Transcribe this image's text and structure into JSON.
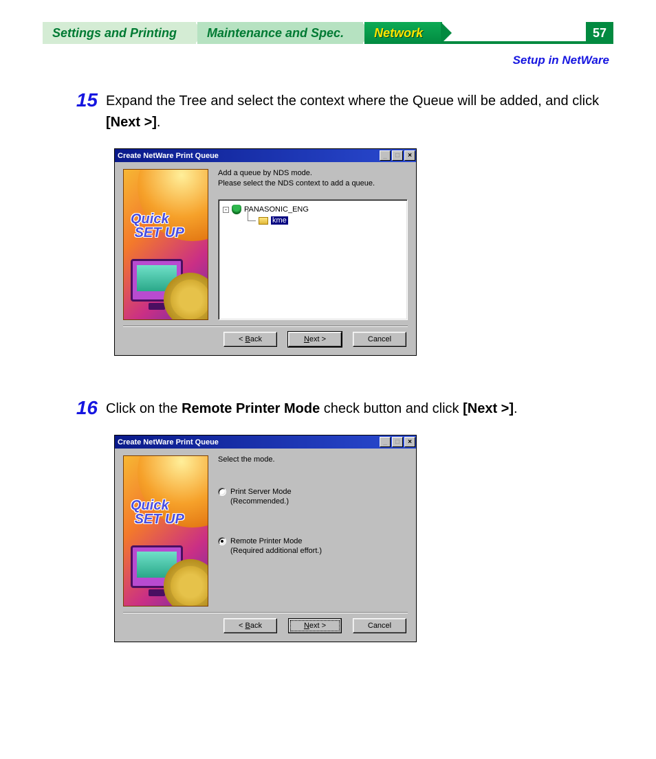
{
  "header": {
    "tabs": {
      "settings": "Settings and Printing",
      "maintenance": "Maintenance and Spec.",
      "network": "Network"
    },
    "page_number": "57",
    "breadcrumb": "Setup in NetWare"
  },
  "step15": {
    "number": "15",
    "text_a": "Expand the Tree and select the context where the Queue will be added, and click ",
    "text_bold": "[Next >]",
    "text_b": ".",
    "dialog": {
      "title": "Create NetWare Print Queue",
      "msg1": "Add a queue by NDS mode.",
      "msg2": "Please select the NDS context to add a queue.",
      "sideart_line1": "Quick",
      "sideart_line2": "SET UP",
      "tree": {
        "root": "PANASONIC_ENG",
        "child_selected": "kme"
      },
      "buttons": {
        "back": "< Back",
        "next": "Next >",
        "cancel": "Cancel"
      }
    }
  },
  "step16": {
    "number": "16",
    "text_a": "Click on the ",
    "text_bold1": "Remote Printer Mode",
    "text_mid": " check button and click ",
    "text_bold2": "[Next >]",
    "text_b": ".",
    "dialog": {
      "title": "Create NetWare Print Queue",
      "msg1": "Select the mode.",
      "sideart_line1": "Quick",
      "sideart_line2": "SET UP",
      "mode": {
        "server_label": "Print Server Mode",
        "server_note": "(Recommended.)",
        "remote_label": "Remote Printer Mode",
        "remote_note": "(Required additional effort.)",
        "selected": "remote"
      },
      "buttons": {
        "back": "< Back",
        "next": "Next >",
        "cancel": "Cancel"
      }
    }
  }
}
